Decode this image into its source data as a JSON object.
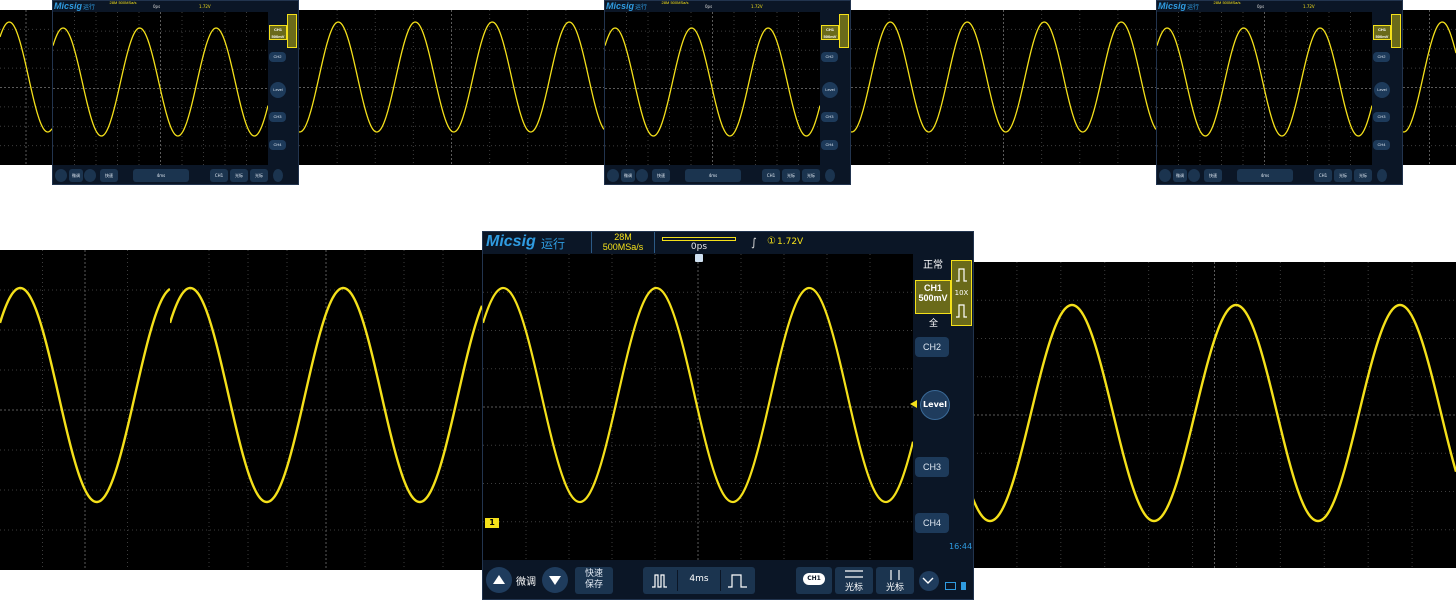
{
  "scope": {
    "brand": "Micsig",
    "run_state": "运行",
    "memory_depth": "28M",
    "sample_rate": "500MSa/s",
    "horizontal_offset": "0ps",
    "trigger_level": "1.72V",
    "trigger_mode": "正常",
    "probe_ratio": "10X",
    "ch1": {
      "name": "CH1",
      "scale": "500mV",
      "bandwidth": "全",
      "coupling": "—"
    },
    "ch2": "CH2",
    "ch3": "CH3",
    "ch4": "CH4",
    "level": "Level",
    "ch1_marker": "1",
    "clock": "16:44",
    "bottom": {
      "fine_tune": "微调",
      "quick_save_line1": "快速",
      "quick_save_line2": "保存",
      "timebase": "4ms",
      "cursor_label": "光标",
      "cursor_label_2": "光标",
      "ch1_chip": "CH1"
    }
  },
  "waveform": {
    "color": "#f4e01a",
    "shape": "sine",
    "cycles_on_screen": 2.8
  },
  "colors": {
    "background": "#000000",
    "frame": "#0b1626",
    "accent": "#2f9be0",
    "trace": "#f4e01a",
    "grid": "#3a3a3a"
  }
}
